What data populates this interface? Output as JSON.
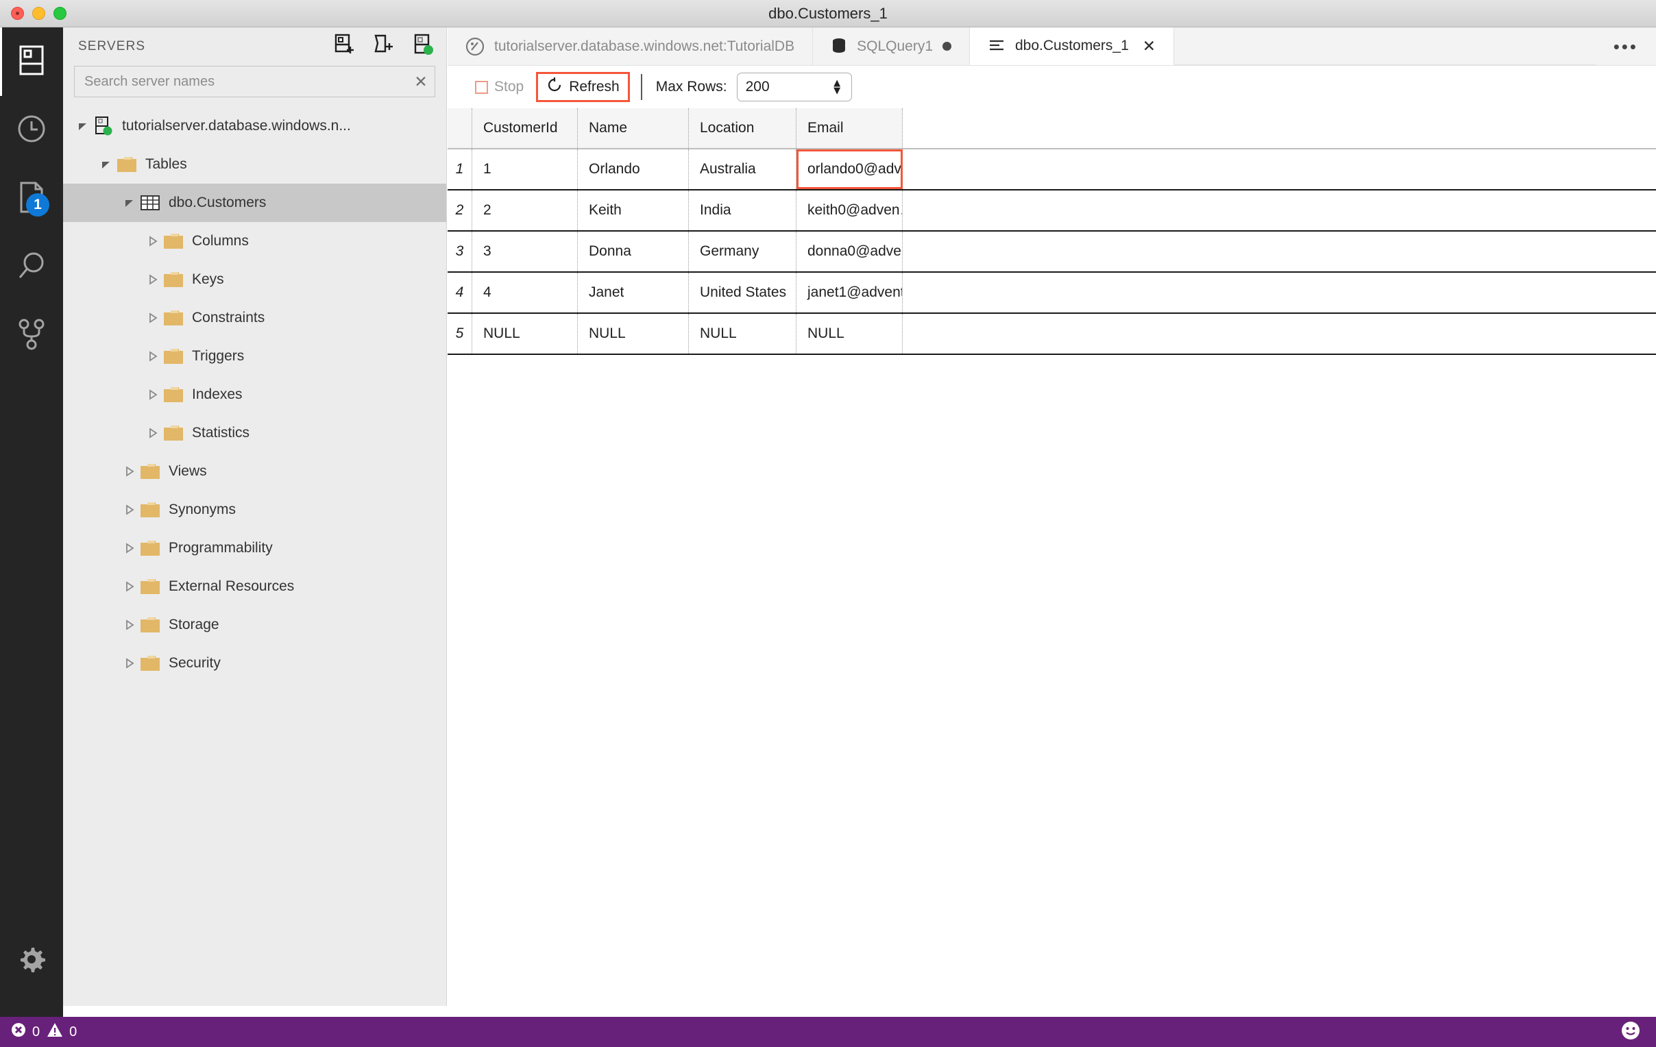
{
  "window": {
    "title": "dbo.Customers_1",
    "controls": [
      "close",
      "minimize",
      "maximize"
    ]
  },
  "activitybar": {
    "items": [
      {
        "name": "servers-icon",
        "label": "Servers",
        "selected": true,
        "badge": null
      },
      {
        "name": "history-clock-icon",
        "label": "Task History",
        "selected": false,
        "badge": null
      },
      {
        "name": "file-page-icon",
        "label": "Open Editors",
        "selected": false,
        "badge": "1"
      },
      {
        "name": "search-magnifier-icon",
        "label": "Search",
        "selected": false,
        "badge": null
      },
      {
        "name": "source-control-branch-icon",
        "label": "Source Control",
        "selected": false,
        "badge": null
      }
    ],
    "bottom": {
      "name": "gear-icon",
      "label": "Manage"
    }
  },
  "sidebar": {
    "title": "SERVERS",
    "actions": [
      {
        "name": "add-connection-icon",
        "label": "New Connection"
      },
      {
        "name": "add-server-group-icon",
        "label": "New Server Group"
      },
      {
        "name": "server-connected-icon",
        "label": "Show Active Connections"
      }
    ],
    "search": {
      "placeholder": "Search server names",
      "value": "",
      "clear_label": "Clear"
    },
    "tree": [
      {
        "label": "tutorialserver.database.windows.n...",
        "icon": "server-connected-icon",
        "indent": 0,
        "twisty": "expanded",
        "selected": false
      },
      {
        "label": "Tables",
        "icon": "folder-icon",
        "indent": 1,
        "twisty": "expanded",
        "selected": false
      },
      {
        "label": "dbo.Customers",
        "icon": "table-icon",
        "indent": 2,
        "twisty": "expanded",
        "selected": true
      },
      {
        "label": "Columns",
        "icon": "folder-icon",
        "indent": 3,
        "twisty": "collapsed",
        "selected": false
      },
      {
        "label": "Keys",
        "icon": "folder-icon",
        "indent": 3,
        "twisty": "collapsed",
        "selected": false
      },
      {
        "label": "Constraints",
        "icon": "folder-icon",
        "indent": 3,
        "twisty": "collapsed",
        "selected": false
      },
      {
        "label": "Triggers",
        "icon": "folder-icon",
        "indent": 3,
        "twisty": "collapsed",
        "selected": false
      },
      {
        "label": "Indexes",
        "icon": "folder-icon",
        "indent": 3,
        "twisty": "collapsed",
        "selected": false
      },
      {
        "label": "Statistics",
        "icon": "folder-icon",
        "indent": 3,
        "twisty": "collapsed",
        "selected": false
      },
      {
        "label": "Views",
        "icon": "folder-icon",
        "indent": 2,
        "twisty": "collapsed",
        "selected": false
      },
      {
        "label": "Synonyms",
        "icon": "folder-icon",
        "indent": 2,
        "twisty": "collapsed",
        "selected": false
      },
      {
        "label": "Programmability",
        "icon": "folder-icon",
        "indent": 2,
        "twisty": "collapsed",
        "selected": false
      },
      {
        "label": "External Resources",
        "icon": "folder-icon",
        "indent": 2,
        "twisty": "collapsed",
        "selected": false
      },
      {
        "label": "Storage",
        "icon": "folder-icon",
        "indent": 2,
        "twisty": "collapsed",
        "selected": false
      },
      {
        "label": "Security",
        "icon": "folder-icon",
        "indent": 2,
        "twisty": "collapsed",
        "selected": false
      }
    ]
  },
  "editor": {
    "tabs": [
      {
        "label": "tutorialserver.database.windows.net:TutorialDB",
        "icon": "dashboard-gauge-icon",
        "active": false,
        "dirty": false,
        "closable": false
      },
      {
        "label": "SQLQuery1",
        "icon": "database-icon",
        "active": false,
        "dirty": true,
        "closable": false
      },
      {
        "label": "dbo.Customers_1",
        "icon": "table-editor-icon",
        "active": true,
        "dirty": false,
        "closable": true
      }
    ],
    "more_label": "•••"
  },
  "toolbar": {
    "stop_label": "Stop",
    "refresh_label": "Refresh",
    "max_rows_label": "Max Rows:",
    "max_rows_value": "200",
    "highlight_color": "#f4563a"
  },
  "grid": {
    "columns": [
      "CustomerId",
      "Name",
      "Location",
      "Email"
    ],
    "rows": [
      {
        "num": "1",
        "cells": [
          "1",
          "Orlando",
          "Australia",
          "orlando0@adv…"
        ]
      },
      {
        "num": "2",
        "cells": [
          "2",
          "Keith",
          "India",
          "keith0@adven…"
        ]
      },
      {
        "num": "3",
        "cells": [
          "3",
          "Donna",
          "Germany",
          "donna0@adve…"
        ]
      },
      {
        "num": "4",
        "cells": [
          "4",
          "Janet",
          "United States",
          "janet1@advent…"
        ]
      },
      {
        "num": "5",
        "cells": [
          "NULL",
          "NULL",
          "NULL",
          "NULL"
        ]
      }
    ],
    "highlighted_cell": {
      "row": 0,
      "col": 3
    }
  },
  "statusbar": {
    "errors_count": "0",
    "warnings_count": "0",
    "feedback": "smiley-icon",
    "background": "#68217a"
  }
}
